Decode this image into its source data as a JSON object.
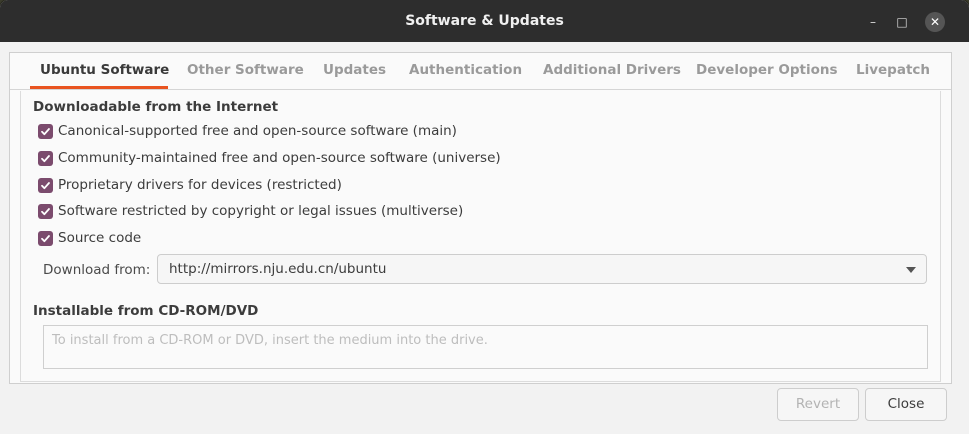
{
  "window": {
    "title": "Software & Updates",
    "controls": {
      "minimize": "–",
      "maximize": "□",
      "close": "✕"
    }
  },
  "tabs": [
    {
      "label": "Ubuntu Software",
      "active": true
    },
    {
      "label": "Other Software",
      "active": false
    },
    {
      "label": "Updates",
      "active": false
    },
    {
      "label": "Authentication",
      "active": false
    },
    {
      "label": "Additional Drivers",
      "active": false
    },
    {
      "label": "Developer Options",
      "active": false
    },
    {
      "label": "Livepatch",
      "active": false
    }
  ],
  "internet": {
    "heading": "Downloadable from the Internet",
    "options": [
      {
        "label": "Canonical-supported free and open-source software (main)",
        "checked": true
      },
      {
        "label": "Community-maintained free and open-source software (universe)",
        "checked": true
      },
      {
        "label": "Proprietary drivers for devices (restricted)",
        "checked": true
      },
      {
        "label": "Software restricted by copyright or legal issues (multiverse)",
        "checked": true
      },
      {
        "label": "Source code",
        "checked": true
      }
    ],
    "download_from_label": "Download from:",
    "download_from_value": "http://mirrors.nju.edu.cn/ubuntu"
  },
  "cdrom": {
    "heading": "Installable from CD-ROM/DVD",
    "placeholder": "To install from a CD-ROM or DVD, insert the medium into the drive."
  },
  "buttons": {
    "revert": "Revert",
    "close": "Close"
  },
  "colors": {
    "accent": "#e95420",
    "checkbox": "#7b4b6d",
    "titlebar": "#2d2d2d"
  }
}
